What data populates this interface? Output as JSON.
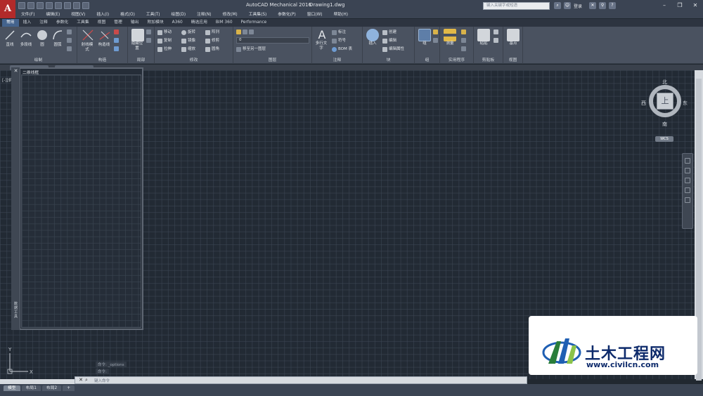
{
  "titlebar": {
    "app_title": "AutoCAD Mechanical 2016",
    "file_name": "Drawing1.dwg",
    "search_placeholder": "键入关键字或短语",
    "login_label": "登录",
    "logo_letter": "A"
  },
  "menu": [
    "文件(F)",
    "编辑(E)",
    "视图(V)",
    "插入(I)",
    "格式(O)",
    "工具(T)",
    "绘图(D)",
    "注释(N)",
    "修改(M)",
    "工具集(S)",
    "参数化(P)",
    "窗口(W)",
    "帮助(H)"
  ],
  "ribbon_tabs": [
    "常用",
    "插入",
    "注释",
    "参数化",
    "工具集",
    "视图",
    "管理",
    "输出",
    "附加模块",
    "A360",
    "精选应用",
    "BIM 360",
    "Performance"
  ],
  "ribbon": {
    "draw": {
      "title": "绘制",
      "line": "直线",
      "polyline": "多段线",
      "circle": "圆",
      "arc": "圆弧"
    },
    "construct": {
      "title": "构造",
      "ray_mode": "射线模式",
      "construct_line": "构造线"
    },
    "detail": {
      "title": "局部",
      "hide": "隐藏位置"
    },
    "modify": {
      "title": "修改",
      "move": "移动",
      "rotate": "旋转",
      "array": "阵列",
      "copy": "复制",
      "mirror": "镜像",
      "trim": "修剪",
      "stretch": "拉伸",
      "scale": "缩放",
      "fillet": "圆角"
    },
    "layers": {
      "title": "图层",
      "current_layer": "0",
      "move_to_layer": "移至另一图层"
    },
    "annotation": {
      "title": "注释",
      "mtext": "多行文字",
      "dimension": "标注",
      "symbol": "符号",
      "bom": "BOM 表"
    },
    "block": {
      "title": "块",
      "insert": "插入",
      "create": "创建",
      "edit": "编辑",
      "edit_attr": "编辑属性"
    },
    "group": {
      "title": "组",
      "group": "组"
    },
    "utilities": {
      "title": "实用程序",
      "measure": "测量"
    },
    "clipboard": {
      "title": "剪贴板",
      "paste": "粘贴"
    },
    "view": {
      "title": "视图",
      "base": "基点"
    }
  },
  "viewport": {
    "label": "[-][俯视][二维线框]",
    "palette_title": "二维线框",
    "palette_side": "数据工具"
  },
  "viewcube": {
    "north": "北",
    "south": "南",
    "east": "东",
    "west": "西",
    "face": "上",
    "wcs": "WCS"
  },
  "ucs": {
    "x": "X",
    "y": "Y"
  },
  "command": {
    "prompt": "键入命令",
    "history1": "命令: _options",
    "history2": "命令:"
  },
  "layouts": [
    "模型",
    "布局1",
    "布局2",
    "+"
  ],
  "watermark": {
    "name": "土木工程网",
    "url": "www.civilcn.com"
  }
}
